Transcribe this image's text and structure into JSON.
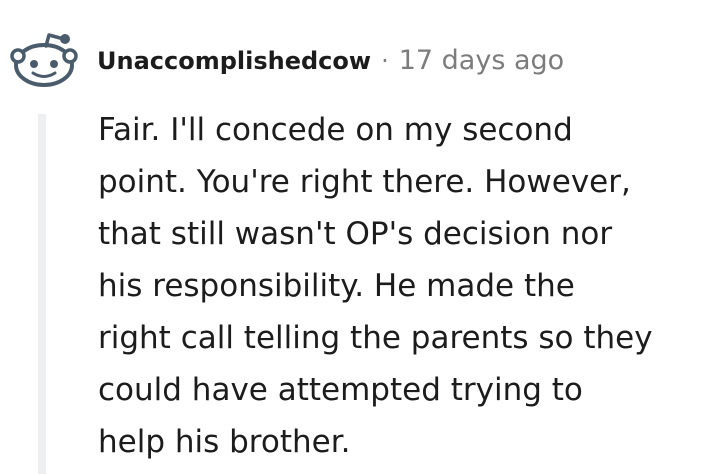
{
  "comment": {
    "author": "Unaccomplishedcow",
    "separator": "·",
    "time_ago": "17 days ago",
    "body": "Fair. I'll concede on my second\npoint. You're right there. However,\nthat still wasn't OP's decision nor\nhis responsibility. He made the\nright call telling the parents so they\ncould have attempted trying to\nhelp his brother."
  },
  "icons": {
    "avatar": "reddit-snoo-avatar-icon"
  },
  "colors": {
    "text": "#1c1c1c",
    "meta": "#7c7c7c",
    "thread_line": "#edeff1",
    "avatar_outline": "#4a5b6b",
    "avatar_fill": "#ffffff"
  }
}
